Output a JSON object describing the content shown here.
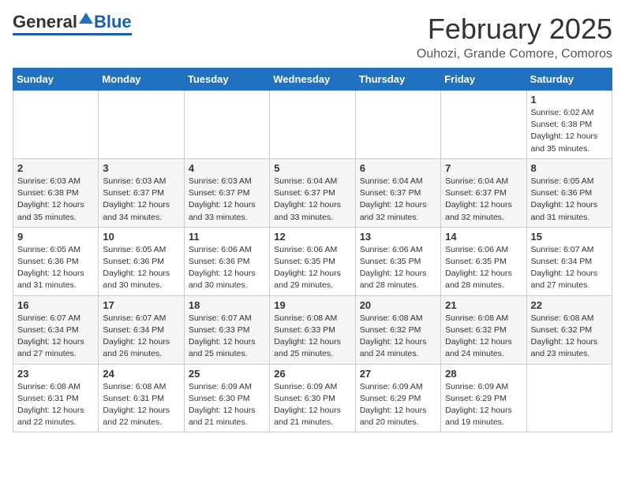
{
  "logo": {
    "general": "General",
    "blue": "Blue"
  },
  "header": {
    "month": "February 2025",
    "location": "Ouhozi, Grande Comore, Comoros"
  },
  "days_of_week": [
    "Sunday",
    "Monday",
    "Tuesday",
    "Wednesday",
    "Thursday",
    "Friday",
    "Saturday"
  ],
  "weeks": [
    [
      {
        "day": "",
        "info": ""
      },
      {
        "day": "",
        "info": ""
      },
      {
        "day": "",
        "info": ""
      },
      {
        "day": "",
        "info": ""
      },
      {
        "day": "",
        "info": ""
      },
      {
        "day": "",
        "info": ""
      },
      {
        "day": "1",
        "info": "Sunrise: 6:02 AM\nSunset: 6:38 PM\nDaylight: 12 hours and 35 minutes."
      }
    ],
    [
      {
        "day": "2",
        "info": "Sunrise: 6:03 AM\nSunset: 6:38 PM\nDaylight: 12 hours and 35 minutes."
      },
      {
        "day": "3",
        "info": "Sunrise: 6:03 AM\nSunset: 6:37 PM\nDaylight: 12 hours and 34 minutes."
      },
      {
        "day": "4",
        "info": "Sunrise: 6:03 AM\nSunset: 6:37 PM\nDaylight: 12 hours and 33 minutes."
      },
      {
        "day": "5",
        "info": "Sunrise: 6:04 AM\nSunset: 6:37 PM\nDaylight: 12 hours and 33 minutes."
      },
      {
        "day": "6",
        "info": "Sunrise: 6:04 AM\nSunset: 6:37 PM\nDaylight: 12 hours and 32 minutes."
      },
      {
        "day": "7",
        "info": "Sunrise: 6:04 AM\nSunset: 6:37 PM\nDaylight: 12 hours and 32 minutes."
      },
      {
        "day": "8",
        "info": "Sunrise: 6:05 AM\nSunset: 6:36 PM\nDaylight: 12 hours and 31 minutes."
      }
    ],
    [
      {
        "day": "9",
        "info": "Sunrise: 6:05 AM\nSunset: 6:36 PM\nDaylight: 12 hours and 31 minutes."
      },
      {
        "day": "10",
        "info": "Sunrise: 6:05 AM\nSunset: 6:36 PM\nDaylight: 12 hours and 30 minutes."
      },
      {
        "day": "11",
        "info": "Sunrise: 6:06 AM\nSunset: 6:36 PM\nDaylight: 12 hours and 30 minutes."
      },
      {
        "day": "12",
        "info": "Sunrise: 6:06 AM\nSunset: 6:35 PM\nDaylight: 12 hours and 29 minutes."
      },
      {
        "day": "13",
        "info": "Sunrise: 6:06 AM\nSunset: 6:35 PM\nDaylight: 12 hours and 28 minutes."
      },
      {
        "day": "14",
        "info": "Sunrise: 6:06 AM\nSunset: 6:35 PM\nDaylight: 12 hours and 28 minutes."
      },
      {
        "day": "15",
        "info": "Sunrise: 6:07 AM\nSunset: 6:34 PM\nDaylight: 12 hours and 27 minutes."
      }
    ],
    [
      {
        "day": "16",
        "info": "Sunrise: 6:07 AM\nSunset: 6:34 PM\nDaylight: 12 hours and 27 minutes."
      },
      {
        "day": "17",
        "info": "Sunrise: 6:07 AM\nSunset: 6:34 PM\nDaylight: 12 hours and 26 minutes."
      },
      {
        "day": "18",
        "info": "Sunrise: 6:07 AM\nSunset: 6:33 PM\nDaylight: 12 hours and 25 minutes."
      },
      {
        "day": "19",
        "info": "Sunrise: 6:08 AM\nSunset: 6:33 PM\nDaylight: 12 hours and 25 minutes."
      },
      {
        "day": "20",
        "info": "Sunrise: 6:08 AM\nSunset: 6:32 PM\nDaylight: 12 hours and 24 minutes."
      },
      {
        "day": "21",
        "info": "Sunrise: 6:08 AM\nSunset: 6:32 PM\nDaylight: 12 hours and 24 minutes."
      },
      {
        "day": "22",
        "info": "Sunrise: 6:08 AM\nSunset: 6:32 PM\nDaylight: 12 hours and 23 minutes."
      }
    ],
    [
      {
        "day": "23",
        "info": "Sunrise: 6:08 AM\nSunset: 6:31 PM\nDaylight: 12 hours and 22 minutes."
      },
      {
        "day": "24",
        "info": "Sunrise: 6:08 AM\nSunset: 6:31 PM\nDaylight: 12 hours and 22 minutes."
      },
      {
        "day": "25",
        "info": "Sunrise: 6:09 AM\nSunset: 6:30 PM\nDaylight: 12 hours and 21 minutes."
      },
      {
        "day": "26",
        "info": "Sunrise: 6:09 AM\nSunset: 6:30 PM\nDaylight: 12 hours and 21 minutes."
      },
      {
        "day": "27",
        "info": "Sunrise: 6:09 AM\nSunset: 6:29 PM\nDaylight: 12 hours and 20 minutes."
      },
      {
        "day": "28",
        "info": "Sunrise: 6:09 AM\nSunset: 6:29 PM\nDaylight: 12 hours and 19 minutes."
      },
      {
        "day": "",
        "info": ""
      }
    ]
  ]
}
